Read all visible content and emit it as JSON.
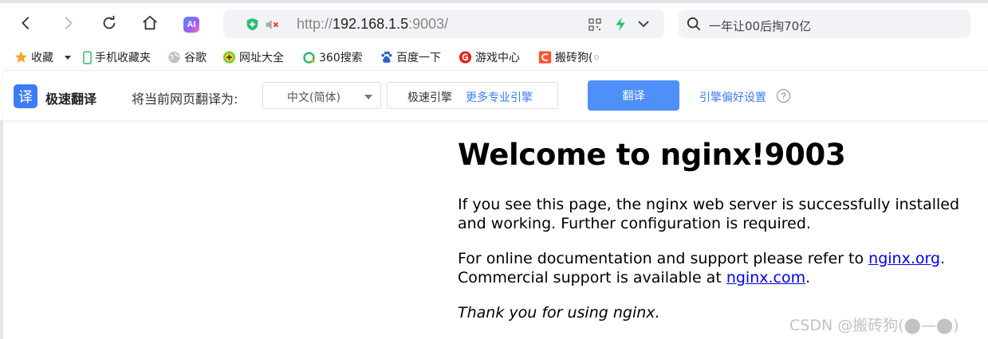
{
  "browser": {
    "url_prefix": "http://",
    "url_host": "192.168.1.5",
    "url_suffix": ":9003/",
    "search_placeholder": "一年让00后掏70亿",
    "ai_label": "AI"
  },
  "bookmarks": [
    {
      "label": "收藏",
      "icon": "star-icon"
    },
    {
      "label": "手机收藏夹",
      "icon": "phone-icon"
    },
    {
      "label": "谷歌",
      "icon": "globe-icon"
    },
    {
      "label": "网址大全",
      "icon": "plus-circle-icon"
    },
    {
      "label": "360搜索",
      "icon": "search360-icon"
    },
    {
      "label": "百度一下",
      "icon": "paw-icon"
    },
    {
      "label": "游戏中心",
      "icon": "game-icon"
    },
    {
      "label": "搬砖狗(",
      "icon": "csdn-icon"
    }
  ],
  "translate": {
    "logo": "译",
    "title": "极速翻译",
    "prompt": "将当前网页翻译为:",
    "language": "中文(简体)",
    "engine": "极速引擎",
    "more_engines": "更多专业引擎",
    "button": "翻译",
    "preferences": "引擎偏好设置",
    "help": "?"
  },
  "page": {
    "title": "Welcome to nginx!9003",
    "p1": "If you see this page, the nginx web server is successfully installed and working. Further configuration is required.",
    "p2_before": "For online documentation and support please refer to ",
    "p2_link1": "nginx.org",
    "p2_mid": ".",
    "p2_line2": "Commercial support is available at ",
    "p2_link2": "nginx.com",
    "p2_end": ".",
    "p3": "Thank you for using nginx."
  },
  "watermark": "CSDN @搬砖狗(⬤—⬤)",
  "colors": {
    "accent": "#3d7cf4",
    "translate_button": "#4e8ff8",
    "link": "#0000ee"
  }
}
